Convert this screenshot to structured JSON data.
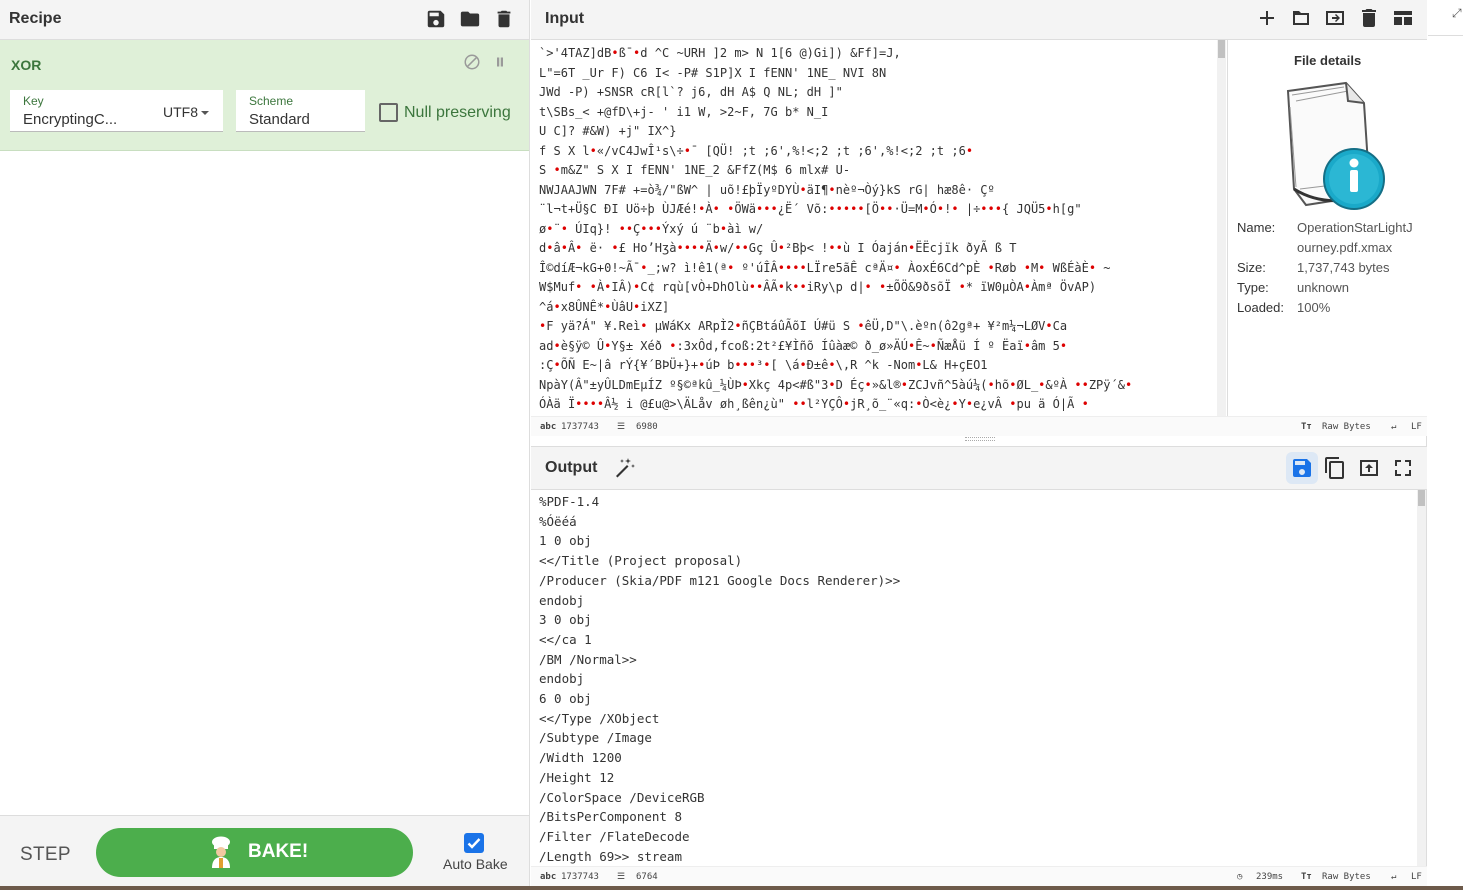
{
  "recipe": {
    "title": "Recipe",
    "operation": {
      "name": "XOR",
      "key_label": "Key",
      "key_value": "EncryptingC...",
      "encoding": "UTF8",
      "scheme_label": "Scheme",
      "scheme_value": "Standard",
      "null_preserving_label": "Null preserving",
      "null_preserving_checked": false
    },
    "step_label": "STEP",
    "bake_label": "BAKE!",
    "auto_bake_label": "Auto Bake",
    "auto_bake_checked": true
  },
  "input": {
    "title": "Input",
    "lines": [
      "`>'4TAZ]dB•ß¯•d  ^C    ~URH  ]2    m>              N  1[6    @)Gi])        &Ff]=J,",
      "L\"=6T  _Ur        F)  C6        I<   -P#    S1P]X      I  fENN'  1NE_        NVI      8N",
      "    JWd   -P)    +SNSR      cR[l`?     j6,           dH  A$    Q  NL;          dH  ]\"",
      "t\\SBs_<    +@fD\\+j-          '        i1  W,      >2~F,    7G    b*          N_I",
      "U   C]?      #&W)   +j\"         IX^}",
      "f     S     X   l•«/vC4JwÎ¹s\\÷•¯  [QÜ!    ;t   ;6',%!<;2    ;t   ;6',%!<;2    ;t   ;6•",
      "     S    •m&Z\"      S       X          I    fENN'  1NE_2        &FfZ(M$       6      mlx#    U-",
      "NWJAAJWN   7F#     +=ò¾/\"ßW^    |   uõ!£þÏyºDYÙ•äI¶•nèº¬Òý}kS  rG|      hæ8ê·  Çº",
      "¨l¬t+Ü§C  ÐI   Uö÷þ  ÙJÆé!•À•     •ÖWä•••¿Ë´  Võ:•••••[Ö••·Ü=M•Ó•!•    |÷•••{  JQÜ5•h[g\"",
      "ø•¨•  ÚIq}! ••Ç•••Ýxý  ú  ¨b•àì  w/",
      "  d•â•Â•   ë·   •£   HoʼHʒà••••Ä•w/••Gç Û•²Bþ<   !••ù    I  Óaján•ËËcjïk  ðyÃ   ß  T",
      "Î©díÆ¬kG+0!~Ã¯•_;w?  ì!ê1(ª•  º'úÎÂ••••LÏre5ãÊ  cªÄ¤•  ÀoxÉ6Cd^pÈ  •Røb  •M•  WßÉàÈ•  ~",
      "W$Muf•   •À•IÂ)•C¢  rqù[vÒ+DhOlù••ÂÃ•k••iRy\\p  d|•  •±ÕÖ&9ðsõÏ   •*   ïW0µÒA•Àmª  ÖvAP)",
      "  ^á•x8ÛNÊ*•ÙâU•iXZ]",
      "•F  yä?Á\"  ¥.Reì•  µWáKx  ARpÌ2•ñÇBtáûÃõI  Ú#ü  S  •êÜ,D\"\\.èºn(ô2gª+  ¥²m¼¬LØV•Ca",
      "ad•è§ÿ©  Û•Y§±  Xéð  •:3xÔd,fcoß:2t²£¥Ìñõ  Íûàæ©   ð_ø»ÄÚ•Ê~•ÑæÅü  Í  º  Ëaï•âm  5•",
      ":Ç•ÕÑ   E~|â  rÝ{¥´BÞÜ+}+•úÞ  b•••³•[  \\á•Ð±ê•\\,R ^k -Nom•L&    H+çEO1",
      "NpàY(Â\"±yÛLDmEµÍZ   º§©ªkû_¼ÙÞ•Xkç  4p<#ß\"3•D  Éç•»&l®•ZCJvñ^5àú¼(•hõ•ØL_•&ºÀ  ••ZPÿ´&•",
      "  ÓÀä  Ï••••Â½  i  @£u@>\\ÄLåv  øh¸ßên¿ù\"  ••l²YÇÔ•jR¸õ_¨«q:•Ò<è¿•Y•e¿vÂ  •pu   ä  Ó|Ã  •"
    ],
    "status": {
      "length": "1737743",
      "lines": "6980",
      "raw_bytes": "Raw Bytes",
      "eol": "LF"
    }
  },
  "file_details": {
    "title": "File details",
    "name_label": "Name:",
    "name_value": "OperationStarLightJourney.pdf.xmax",
    "name_value_line1": "OperationStarLightJ",
    "name_value_line2": "ourney.pdf.xmax",
    "size_label": "Size:",
    "size_value": "1,737,743 bytes",
    "type_label": "Type:",
    "type_value": "unknown",
    "loaded_label": "Loaded:",
    "loaded_value": "100%"
  },
  "output": {
    "title": "Output",
    "text": "%PDF-1.4\n%Óëéá\n1 0 obj\n<</Title (Project proposal)\n/Producer (Skia/PDF m121 Google Docs Renderer)>>\nendobj\n3 0 obj\n<</ca 1\n/BM /Normal>>\nendobj\n6 0 obj\n<</Type /XObject\n/Subtype /Image\n/Width 1200\n/Height 12\n/ColorSpace /DeviceRGB\n/BitsPerComponent 8\n/Filter /FlateDecode\n/Length 69>> stream",
    "status": {
      "length": "1737743",
      "lines": "6764",
      "time": "239ms",
      "raw_bytes": "Raw Bytes",
      "eol": "LF"
    }
  },
  "icons": {
    "save": "save-icon",
    "folder": "folder-icon",
    "trash": "trash-icon",
    "plus": "plus-icon",
    "magic": "magic-wand-icon",
    "accent": "#1a73e8",
    "green": "#4cae4c"
  }
}
